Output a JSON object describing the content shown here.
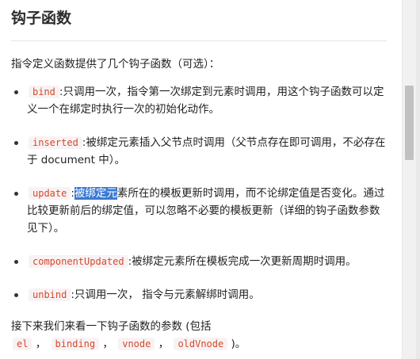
{
  "section": {
    "title": "钩子函数",
    "intro": "指令定义函数提供了几个钩子函数（可选）："
  },
  "hooks": [
    {
      "name": "bind",
      "desc": ":只调用一次，指令第一次绑定到元素时调用，用这个钩子函数可以定义一个在绑定时执行一次的初始化动作。"
    },
    {
      "name": "inserted",
      "desc": ":被绑定元素插入父节点时调用（父节点存在即可调用，不必存在于 document 中）。"
    },
    {
      "name": "update",
      "desc_prefix": ":",
      "desc_highlight": "被绑定元",
      "desc_rest": "素所在的模板更新时调用，而不论绑定值是否变化。通过比较更新前后的绑定值，可以忽略不必要的模板更新（详细的钩子函数参数见下）。"
    },
    {
      "name": "componentUpdated",
      "desc": ":被绑定元素所在模板完成一次更新周期时调用。"
    },
    {
      "name": "unbind",
      "desc": ":只调用一次， 指令与元素解绑时调用。"
    }
  ],
  "outro": {
    "text": "接下来我们来看一下钩子函数的参数 (包括",
    "params": [
      "el",
      "binding",
      "vnode",
      "oldVnode"
    ],
    "sep": " ，",
    "end": " )。"
  },
  "colors": {
    "code_text": "#d14b2a",
    "code_bg": "#f9f2f4",
    "selection": "#3a7bd5"
  }
}
